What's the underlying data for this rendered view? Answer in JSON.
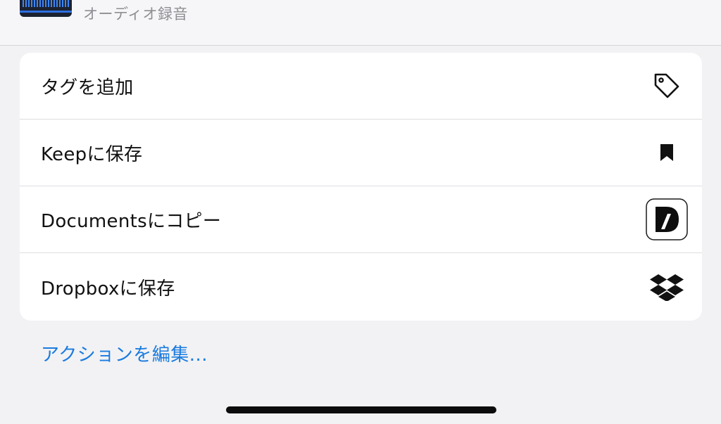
{
  "header": {
    "subtitle": "オーディオ録音",
    "thumbnail_icon": "audio-waveform-thumbnail"
  },
  "actions": {
    "items": [
      {
        "label": "タグを追加",
        "icon": "tag-icon"
      },
      {
        "label": "Keepに保存",
        "icon": "bookmark-icon"
      },
      {
        "label": "Documentsにコピー",
        "icon": "documents-app-icon"
      },
      {
        "label": "Dropboxに保存",
        "icon": "dropbox-icon"
      }
    ]
  },
  "footer": {
    "edit_actions_label": "アクションを編集..."
  },
  "colors": {
    "background": "#f2f2f4",
    "card": "#ffffff",
    "link": "#1a7be0",
    "text": "#111111",
    "subtitle": "#8e8e93"
  }
}
